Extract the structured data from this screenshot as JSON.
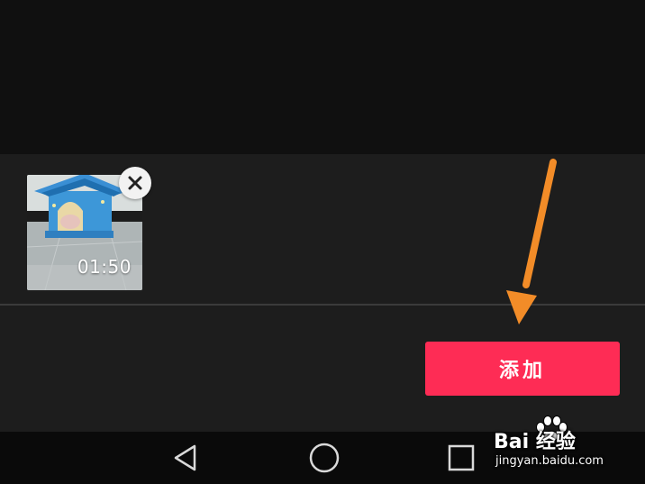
{
  "selected_media": {
    "items": [
      {
        "duration": "01:50",
        "remove_icon": "close-icon"
      }
    ]
  },
  "actions": {
    "add_label": "添加"
  },
  "annotation": {
    "icon": "orange-arrow-pointing-down",
    "color": "#f28c28"
  },
  "nav_bar": {
    "back_icon": "triangle-back-icon",
    "home_icon": "circle-home-icon",
    "recents_icon": "square-recents-icon"
  },
  "watermark": {
    "brand": "Bai 经验",
    "url": "jingyan.baidu.com"
  },
  "colors": {
    "accent": "#fe2c55",
    "panel": "#1d1d1d",
    "background": "#101010"
  }
}
